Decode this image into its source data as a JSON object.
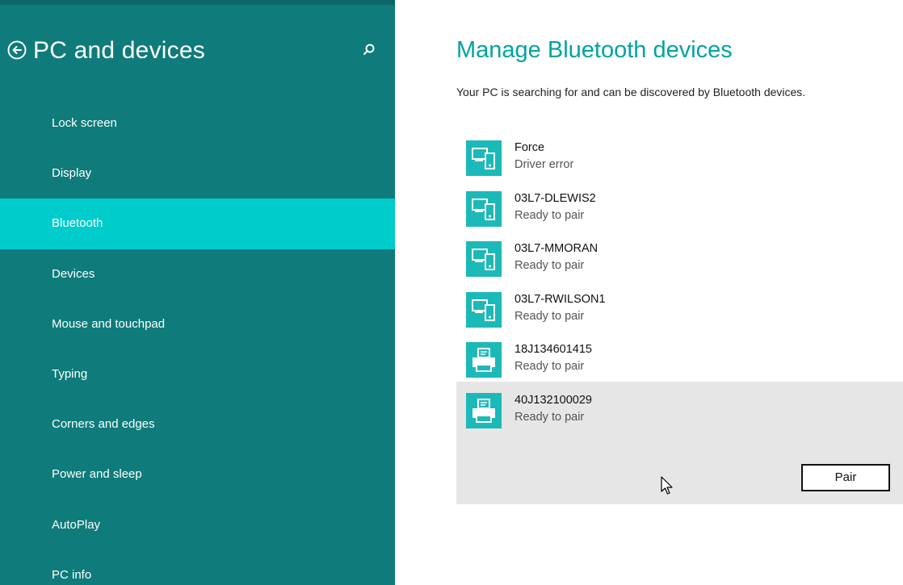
{
  "sidebar": {
    "title": "PC and devices",
    "back_icon": "back-arrow-circle-icon",
    "search_icon": "search-icon",
    "items": [
      {
        "label": "Lock screen"
      },
      {
        "label": "Display"
      },
      {
        "label": "Bluetooth",
        "selected": true
      },
      {
        "label": "Devices"
      },
      {
        "label": "Mouse and touchpad"
      },
      {
        "label": "Typing"
      },
      {
        "label": "Corners and edges"
      },
      {
        "label": "Power and sleep"
      },
      {
        "label": "AutoPlay"
      },
      {
        "label": "PC info"
      }
    ]
  },
  "main": {
    "title": "Manage Bluetooth devices",
    "status": "Your PC is searching for and can be discovered by Bluetooth devices.",
    "devices": [
      {
        "name": "Force",
        "status": "Driver error",
        "icon": "computer-device-icon"
      },
      {
        "name": "03L7-DLEWIS2",
        "status": "Ready to pair",
        "icon": "computer-device-icon"
      },
      {
        "name": "03L7-MMORAN",
        "status": "Ready to pair",
        "icon": "computer-device-icon"
      },
      {
        "name": "03L7-RWILSON1",
        "status": "Ready to pair",
        "icon": "computer-device-icon"
      },
      {
        "name": "18J134601415",
        "status": "Ready to pair",
        "icon": "printer-icon"
      },
      {
        "name": "40J132100029",
        "status": "Ready to pair",
        "icon": "printer-icon",
        "selected": true
      }
    ],
    "pair_label": "Pair"
  },
  "colors": {
    "sidebar_bg": "#0f7b7b",
    "selected_bg": "#00cccc",
    "accent": "#00a3a3",
    "icon_tile": "#1cb9b9",
    "selected_row": "#e6e6e6"
  }
}
